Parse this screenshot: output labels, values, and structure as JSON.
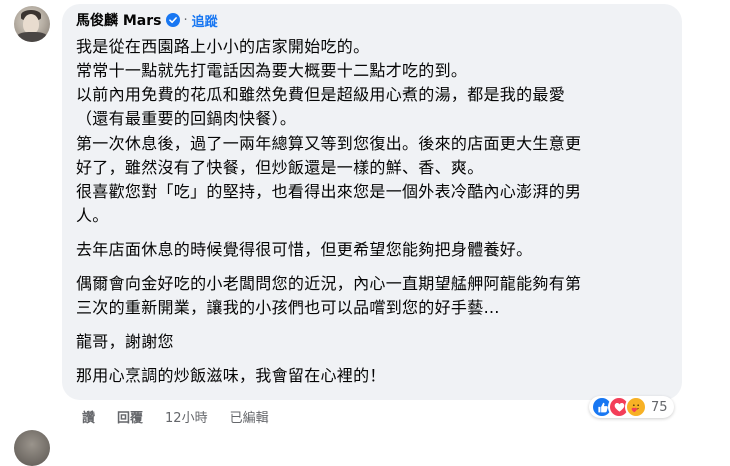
{
  "comment": {
    "author": "馬俊麟 Mars",
    "follow_label": "追蹤",
    "dot": "·",
    "lines": [
      "我是從在西園路上小小的店家開始吃的。",
      "常常十一點就先打電話因為要大概要十二點才吃的到。",
      "以前內用免費的花瓜和雖然免費但是超級用心煮的湯，都是我的最愛",
      "（還有最重要的回鍋肉快餐）。",
      "第一次休息後，過了一兩年總算又等到您復出。後來的店面更大生意更",
      "好了，雖然沒有了快餐，但炒飯還是一樣的鮮、香、爽。",
      "很喜歡您對「吃」的堅持，也看得出來您是一個外表冷酷內心澎湃的男",
      "人。",
      "去年店面休息的時候覺得很可惜，但更希望您能夠把身體養好。",
      "偶爾會向金好吃的小老闆問您的近況，內心一直期望艋舺阿龍能夠有第",
      "三次的重新開業，讓我的小孩們也可以品嚐到您的好手藝…",
      "龍哥，謝謝您",
      "那用心烹調的炒飯滋味，我會留在心裡的！"
    ]
  },
  "actions": {
    "like": "讚",
    "reply": "回覆",
    "time": "12小時",
    "edited": "已編輯"
  },
  "reactions": {
    "icons": [
      "like-icon",
      "love-icon",
      "care-icon"
    ],
    "count": "75"
  },
  "colors": {
    "bubble": "#f0f2f5",
    "link": "#1877f2",
    "meta": "#65676b",
    "text": "#050505"
  }
}
